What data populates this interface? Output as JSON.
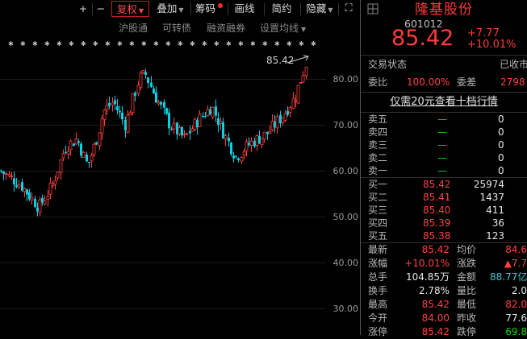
{
  "toolbar": {
    "plus": "+",
    "minus": "−",
    "fuquan": "复权",
    "diejia": "叠加",
    "chouma": "筹码",
    "huaxian": "画线",
    "jianyue": "简约",
    "yincang": "隐藏",
    "expand": "⛶"
  },
  "subbar": {
    "hugutong": "沪股通",
    "kezhuanzhai": "可转债",
    "rongzirongquan": "融资融券",
    "shezhi": "设置均线"
  },
  "axis": {
    "y_labels": [
      "80.00",
      "70.00",
      "60.00",
      "50.00",
      "40.00",
      "30.00"
    ]
  },
  "chart": {
    "price_tag": "85.42"
  },
  "stock": {
    "name": "隆基股份",
    "code": "601012",
    "price": "85.42",
    "change": "+7.77",
    "change_pct": "+10.01%"
  },
  "trade": {
    "status_label": "交易状态",
    "status_value": "已收市",
    "weibi_label": "委比",
    "weibi_value": "100.00%",
    "weicha_label": "委差",
    "weicha_value": "2798"
  },
  "promo": "仅需20元查看十档行情",
  "sell_levels": [
    {
      "label": "卖五",
      "price": "—",
      "vol": "0"
    },
    {
      "label": "卖四",
      "price": "—",
      "vol": "0"
    },
    {
      "label": "卖三",
      "price": "—",
      "vol": "0"
    },
    {
      "label": "卖二",
      "price": "—",
      "vol": "0"
    },
    {
      "label": "卖一",
      "price": "—",
      "vol": "0"
    }
  ],
  "buy_levels": [
    {
      "label": "买一",
      "price": "85.42",
      "vol": "25974"
    },
    {
      "label": "买二",
      "price": "85.41",
      "vol": "1437"
    },
    {
      "label": "买三",
      "price": "85.40",
      "vol": "411"
    },
    {
      "label": "买四",
      "price": "85.39",
      "vol": "36"
    },
    {
      "label": "买五",
      "price": "85.38",
      "vol": "123"
    }
  ],
  "stats": [
    {
      "l1": "最新",
      "v1": "85.42",
      "c1": "red",
      "l2": "均价",
      "v2": "84.6",
      "c2": "red"
    },
    {
      "l1": "涨幅",
      "v1": "+10.01%",
      "c1": "red",
      "l2": "涨跌",
      "v2": "▲7.7",
      "c2": "red"
    },
    {
      "l1": "总手",
      "v1": "104.85万",
      "c1": "white",
      "l2": "金额",
      "v2": "88.77亿",
      "c2": "cyan"
    },
    {
      "l1": "换手",
      "v1": "2.78%",
      "c1": "white",
      "l2": "量比",
      "v2": "2.0",
      "c2": "white"
    },
    {
      "l1": "最高",
      "v1": "85.42",
      "c1": "red",
      "l2": "最低",
      "v2": "82.0",
      "c2": "red"
    },
    {
      "l1": "今开",
      "v1": "84.00",
      "c1": "red",
      "l2": "昨收",
      "v2": "77.6",
      "c2": "white"
    },
    {
      "l1": "涨停",
      "v1": "85.42",
      "c1": "red",
      "l2": "跌停",
      "v2": "69.8",
      "c2": "green"
    }
  ],
  "colors": {
    "up": "#ff4040",
    "down": "#00d2e6",
    "background": "#000000"
  }
}
